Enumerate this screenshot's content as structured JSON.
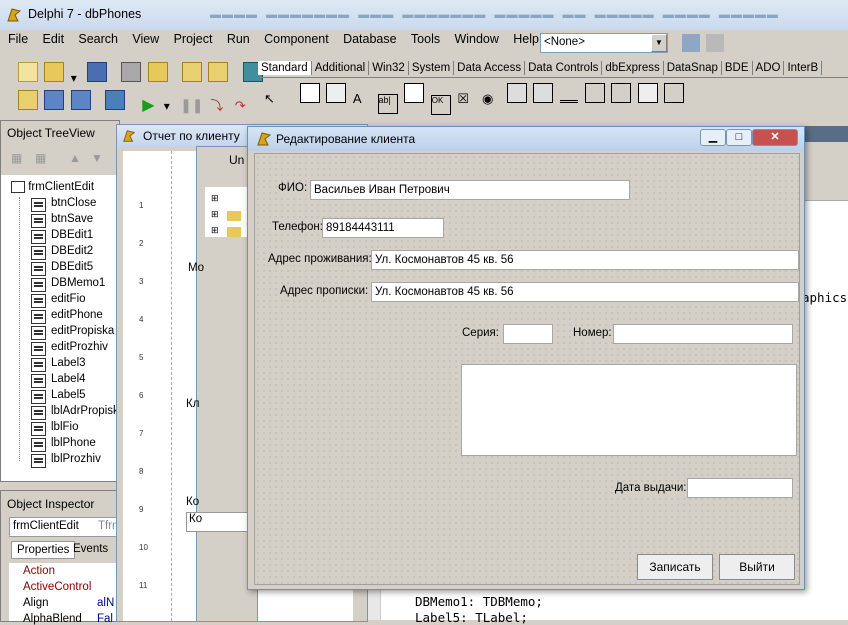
{
  "ide": {
    "title": "Delphi 7 - dbPhones",
    "menu": [
      "File",
      "Edit",
      "Search",
      "View",
      "Project",
      "Run",
      "Component",
      "Database",
      "Tools",
      "Window",
      "Help"
    ],
    "desktop_combo": "<None>",
    "palette_tabs": [
      "Standard",
      "Additional",
      "Win32",
      "System",
      "Data Access",
      "Data Controls",
      "dbExpress",
      "DataSnap",
      "BDE",
      "ADO",
      "InterB"
    ]
  },
  "tree_view": {
    "title": "Object TreeView",
    "root": "frmClientEdit",
    "items": [
      "btnClose",
      "btnSave",
      "DBEdit1",
      "DBEdit2",
      "DBEdit5",
      "DBMemo1",
      "editFio",
      "editPhone",
      "editPropiska",
      "editProzhiv",
      "Label3",
      "Label4",
      "Label5",
      "lblAdrPropiska",
      "lblFio",
      "lblPhone",
      "lblProzhiv"
    ]
  },
  "inspector": {
    "title": "Object Inspector",
    "selected_object": "frmClientEdit",
    "selected_type": "Tfrm",
    "tabs": [
      "Properties",
      "Events"
    ],
    "properties": [
      {
        "name": "Action",
        "value": ""
      },
      {
        "name": "ActiveControl",
        "value": ""
      },
      {
        "name": "Align",
        "value": "alN"
      },
      {
        "name": "AlphaBlend",
        "value": "Fal"
      }
    ]
  },
  "report_window": {
    "title": "Отчет по клиенту"
  },
  "unit_window": {
    "title": "Un",
    "side_labels": [
      "Mo",
      "Кл",
      "Ко",
      "Ко"
    ],
    "ruler": [
      "1",
      "2",
      "3",
      "4",
      "5",
      "6",
      "7",
      "8",
      "9",
      "10",
      "11"
    ]
  },
  "code": {
    "fragment_right": "aphics",
    "lines": [
      "DBMemo1: TDBMemo;",
      "Label5: TLabel;"
    ]
  },
  "dialog": {
    "title": "Редактирование клиента",
    "fio_label": "ФИО:",
    "fio_value": "Васильев Иван Петрович",
    "phone_label": "Телефон:",
    "phone_value": "89184443111",
    "prozhiv_label": "Адрес проживания:",
    "prozhiv_value": "Ул. Космонавтов 45 кв. 56",
    "propiska_label": "Адрес прописки:",
    "propiska_value": "Ул. Космонавтов 45 кв. 56",
    "series_label": "Серия:",
    "series_value": "",
    "number_label": "Номер:",
    "number_value": "",
    "issued_label": "Дата выдачи:",
    "issued_value": "",
    "memo_value": "",
    "save_button": "Записать",
    "exit_button": "Выйти"
  },
  "colors": {
    "title_gradient_top": "#dfe9f5",
    "close_button": "#c75050",
    "property_name": "#8b0000"
  }
}
